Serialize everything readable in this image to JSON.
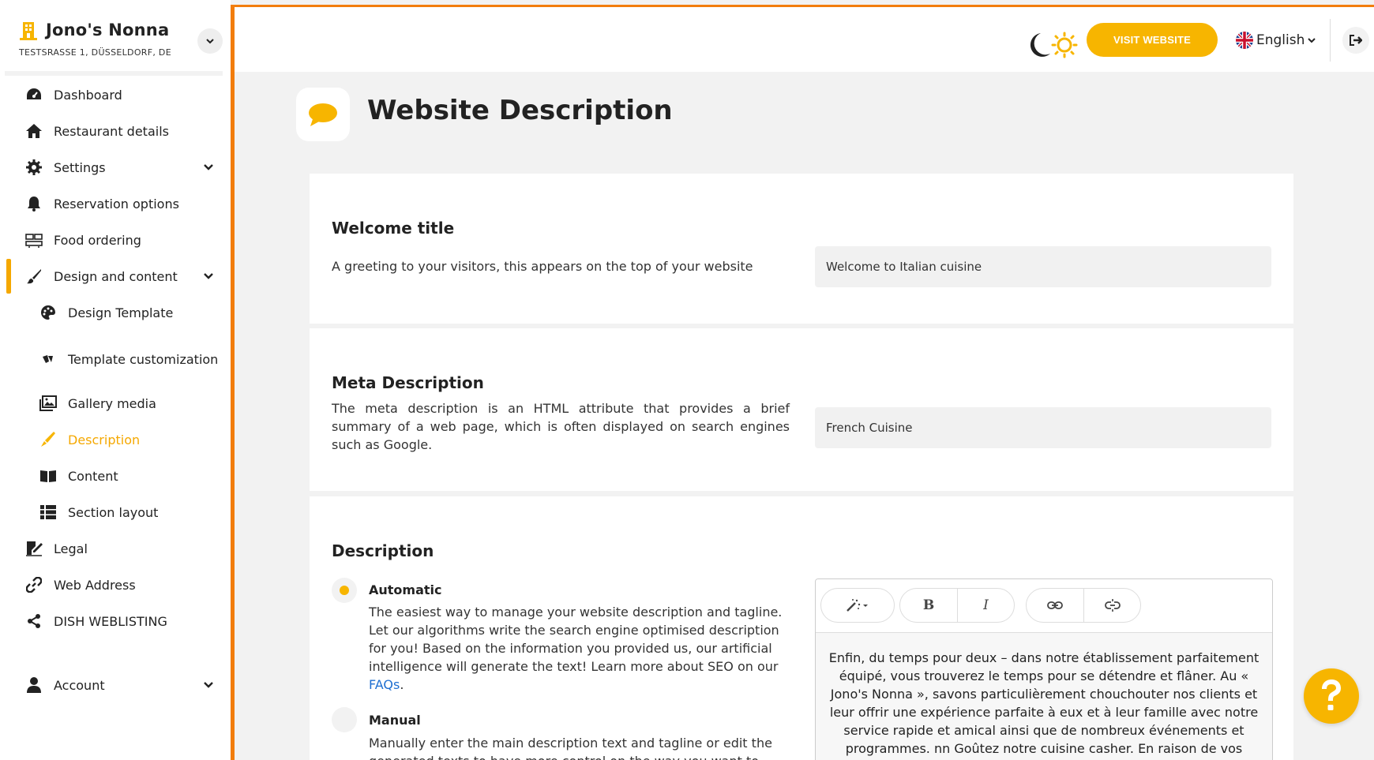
{
  "brand": {
    "name": "Jono's Nonna",
    "address": "TESTSRASSE 1, DÜSSELDORF, DE"
  },
  "sidebar": {
    "items": [
      {
        "label": "Dashboard",
        "icon": "dashboard-icon"
      },
      {
        "label": "Restaurant details",
        "icon": "home-icon"
      },
      {
        "label": "Settings",
        "icon": "gear-icon"
      },
      {
        "label": "Reservation options",
        "icon": "bell-icon"
      },
      {
        "label": "Food ordering",
        "icon": "food-ordering-icon"
      },
      {
        "label": "Design and content",
        "icon": "brush-icon"
      },
      {
        "label": "Design Template",
        "icon": "palette-icon"
      },
      {
        "label": "Template customization",
        "icon": "swatches-icon"
      },
      {
        "label": "Gallery media",
        "icon": "gallery-icon"
      },
      {
        "label": "Description",
        "icon": "pen-icon"
      },
      {
        "label": "Content",
        "icon": "book-icon"
      },
      {
        "label": "Section layout",
        "icon": "list-icon"
      },
      {
        "label": "Legal",
        "icon": "signature-icon"
      },
      {
        "label": "Web Address",
        "icon": "link-icon"
      },
      {
        "label": "DISH WEBLISTING",
        "icon": "share-icon"
      },
      {
        "label": "Account",
        "icon": "user-icon"
      }
    ],
    "active": "Description"
  },
  "header": {
    "visit_label": "VISIT WEBSITE",
    "language": "English"
  },
  "page": {
    "title": "Website Description"
  },
  "welcome": {
    "heading": "Welcome title",
    "text": "A greeting to your visitors, this appears on the top of your website",
    "value": "Welcome to Italian cuisine"
  },
  "meta": {
    "heading": "Meta Description",
    "text": "The meta description is an HTML attribute that provides a brief summary of a web page, which is often displayed on search engines such as Google.",
    "value": "French Cuisine"
  },
  "description": {
    "heading": "Description",
    "auto_label": "Automatic",
    "auto_text": "The easiest way to manage your website description and tagline. Let our algorithms write the search engine optimised description for you! Based on the information you provided us, our artificial intelligence will generate the text! Learn more about SEO on our",
    "faq_link": "FAQs",
    "auto_text_end": ".",
    "manual_label": "Manual",
    "manual_text": "Manually enter the main description text and tagline or edit the generated texts to have more control on the way you want to",
    "editor_text": "Enfin, du temps pour deux – dans notre établissement parfaitement équipé, vous trouverez le temps pour se détendre et flâner. Au « Jono's Nonna », savons particulièrement chouchouter nos clients et leur offrir une expérience parfaite à eux et à leur famille avec notre service rapide et amical ainsi que de nombreux événements et programmes. nn Goûtez notre cuisine casher. En raison de vos"
  },
  "colors": {
    "accent": "#f7b500",
    "frame": "#f27d0c",
    "link": "#1f6fd1"
  }
}
